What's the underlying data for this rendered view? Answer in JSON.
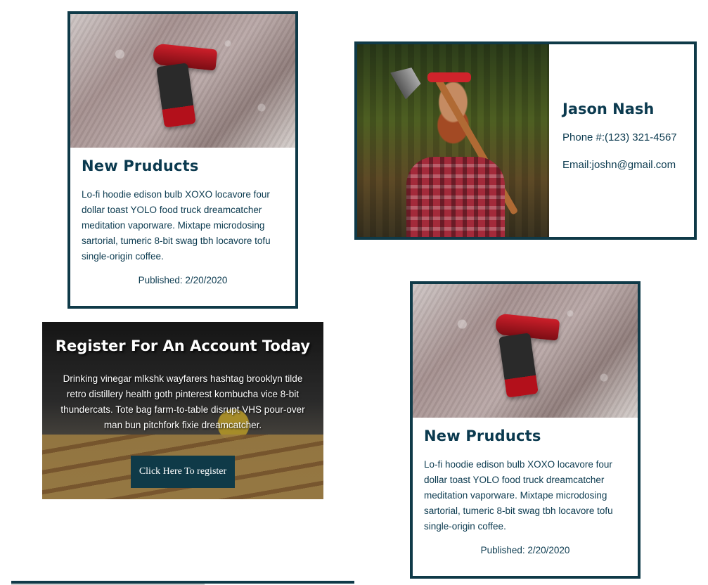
{
  "product_cards": [
    {
      "image_alt": "drill-photo",
      "title": "New Pruducts",
      "description": "Lo-fi hoodie edison bulb XOXO locavore four dollar toast YOLO food truck dreamcatcher meditation vaporware. Mixtape microdosing sartorial, tumeric 8-bit swag tbh locavore tofu single-origin coffee.",
      "published": "Published: 2/20/2020"
    },
    {
      "image_alt": "drill-photo",
      "title": "New Pruducts",
      "description": "Lo-fi hoodie edison bulb XOXO locavore four dollar toast YOLO food truck dreamcatcher meditation vaporware. Mixtape microdosing sartorial, tumeric 8-bit swag tbh locavore tofu single-origin coffee.",
      "published": "Published: 2/20/2020"
    }
  ],
  "profile": {
    "name": "Jason Nash",
    "phone": "Phone #:(123) 321-4567",
    "email": "Email:joshn@gmail.com"
  },
  "register": {
    "title": "Register For An Account Today",
    "text": "Drinking vinegar mlkshk wayfarers hashtag brooklyn tilde retro distillery health goth pinterest kombucha vice 8-bit thundercats. Tote bag farm-to-table disrupt VHS pour-over man bun pitchfork fixie dreamcatcher.",
    "button_label": "Click Here To register"
  },
  "colors": {
    "border": "#0f3a48",
    "text": "#0b3a4f",
    "button_bg": "#0f3a48"
  }
}
